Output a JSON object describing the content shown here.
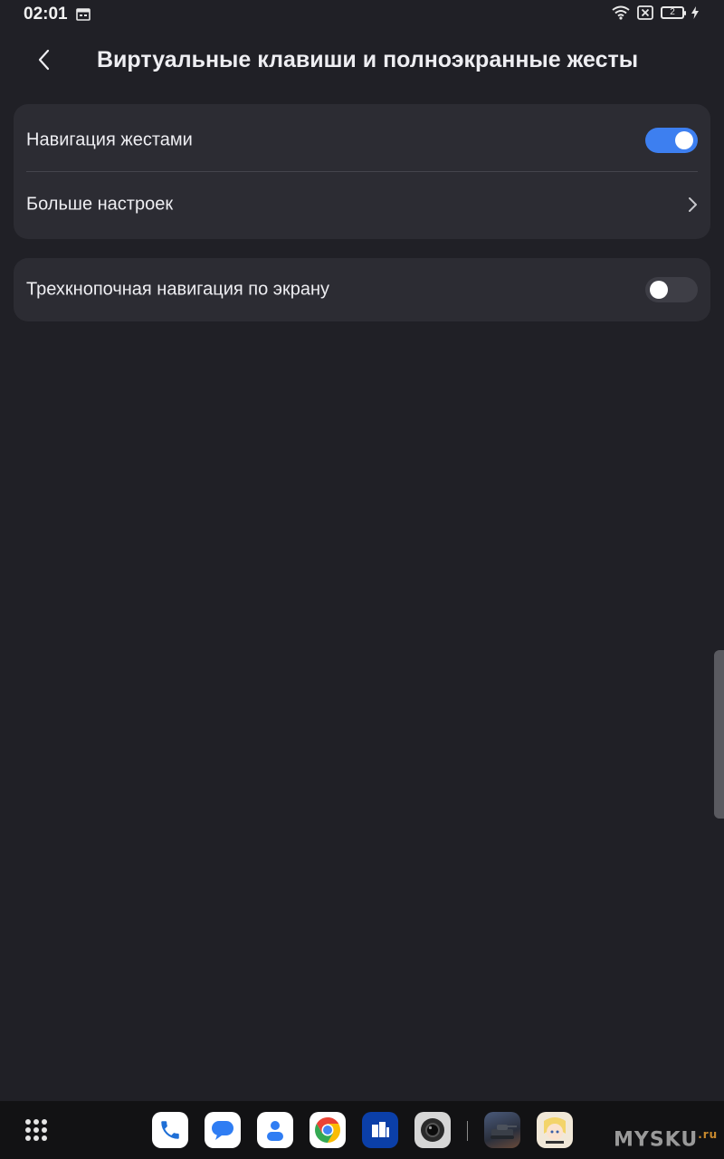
{
  "status_bar": {
    "time": "02:01",
    "icons": [
      "calendar-icon",
      "wifi-icon",
      "sim-off-icon",
      "battery-icon",
      "charging-icon"
    ],
    "battery_text": "2"
  },
  "header": {
    "back_icon": "chevron-left-icon",
    "title": "Виртуальные клавиши и полноэкранные жесты"
  },
  "settings": {
    "gesture_navigation": {
      "label": "Навигация жестами",
      "enabled": true
    },
    "more_settings": {
      "label": "Больше настроек"
    },
    "three_button_navigation": {
      "label": "Трехкнопочная навигация по экрану",
      "enabled": false
    }
  },
  "dock": {
    "apps": [
      "phone",
      "messages",
      "contacts",
      "chrome",
      "files",
      "camera",
      "tank-game",
      "anime-game"
    ]
  },
  "watermark": {
    "text": "MYSKU",
    "suffix": ".ru"
  },
  "colors": {
    "background": "#202026",
    "card": "#2c2c33",
    "accent": "#3d7ff0",
    "toggle_off": "#3e3e46"
  }
}
